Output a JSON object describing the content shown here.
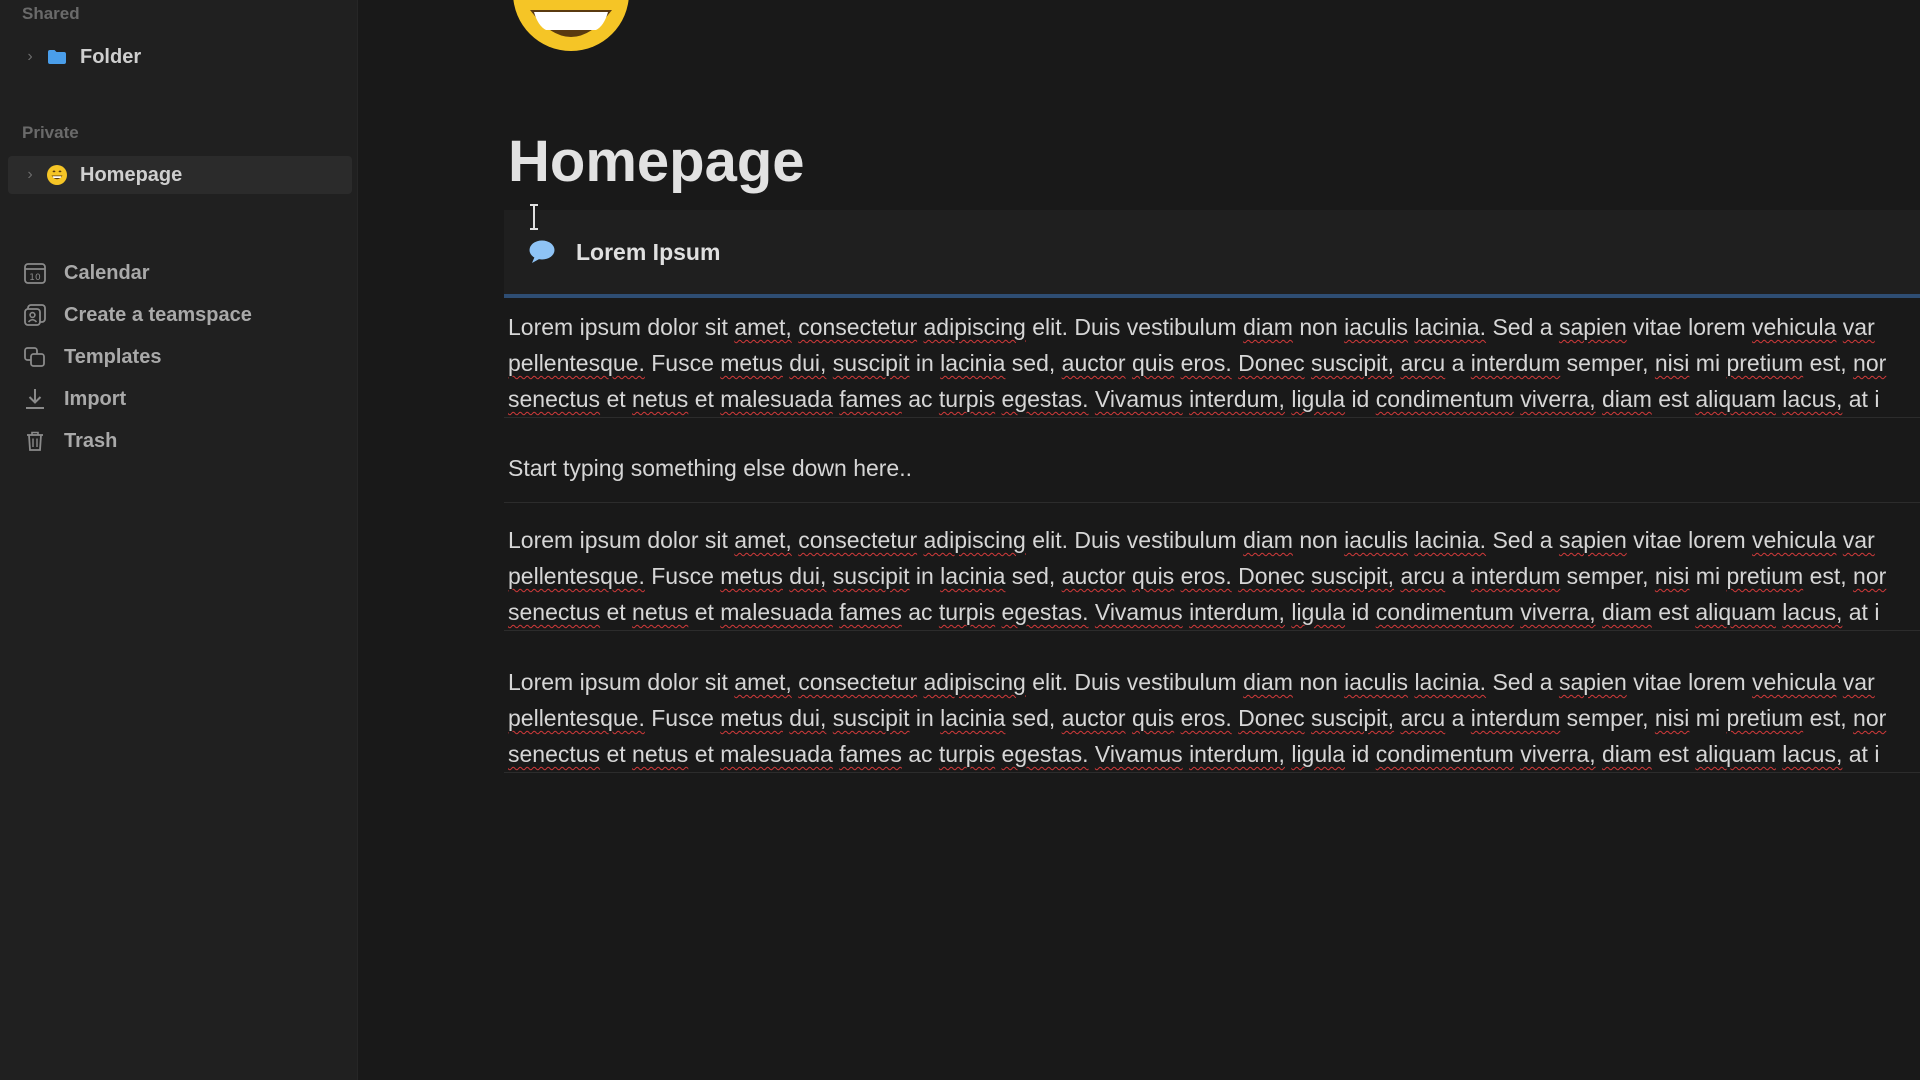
{
  "sidebar": {
    "shared_label": "Shared",
    "private_label": "Private",
    "shared_items": [
      {
        "label": "Folder",
        "icon": "folder-icon"
      }
    ],
    "private_items": [
      {
        "label": "Homepage",
        "icon": "smiley-emoji-icon",
        "active": true
      }
    ],
    "nav": [
      {
        "label": "Calendar",
        "icon": "calendar-icon"
      },
      {
        "label": "Create a teamspace",
        "icon": "teamspace-icon"
      },
      {
        "label": "Templates",
        "icon": "templates-icon"
      },
      {
        "label": "Import",
        "icon": "import-icon"
      },
      {
        "label": "Trash",
        "icon": "trash-icon"
      }
    ]
  },
  "page": {
    "emoji": "smiley-emoji-icon",
    "title": "Homepage",
    "callout": {
      "icon": "speech-bubble-icon",
      "text": "Lorem Ipsum"
    },
    "blocks": [
      {
        "lines": [
          "Lorem ipsum dolor sit amet, consectetur adipiscing elit. Duis vestibulum diam non iaculis lacinia. Sed a sapien vitae lorem vehicula var",
          "pellentesque. Fusce metus dui, suscipit in lacinia sed, auctor quis eros. Donec suscipit, arcu a interdum semper, nisi mi pretium est, nor",
          "senectus et netus et malesuada fames ac turpis egestas. Vivamus interdum, ligula id condimentum viverra, diam est aliquam lacus, at i"
        ]
      },
      {
        "text": "Start typing something else down here.."
      },
      {
        "lines": [
          "Lorem ipsum dolor sit amet, consectetur adipiscing elit. Duis vestibulum diam non iaculis lacinia. Sed a sapien vitae lorem vehicula var",
          "pellentesque. Fusce metus dui, suscipit in lacinia sed, auctor quis eros. Donec suscipit, arcu a interdum semper, nisi mi pretium est, nor",
          "senectus et netus et malesuada fames ac turpis egestas. Vivamus interdum, ligula id condimentum viverra, diam est aliquam lacus, at i"
        ]
      },
      {
        "lines": [
          "Lorem ipsum dolor sit amet, consectetur adipiscing elit. Duis vestibulum diam non iaculis lacinia. Sed a sapien vitae lorem vehicula var",
          "pellentesque. Fusce metus dui, suscipit in lacinia sed, auctor quis eros. Donec suscipit, arcu a interdum semper, nisi mi pretium est, nor",
          "senectus et netus et malesuada fames ac turpis egestas. Vivamus interdum, ligula id condimentum viverra, diam est aliquam lacus, at i"
        ]
      }
    ]
  },
  "colors": {
    "background": "#191919",
    "sidebar": "#202020",
    "callout_accent": "#2e4d73",
    "spellcheck": "#d23a3a",
    "folder_blue": "#4a9eea",
    "emoji_yellow": "#f5c526"
  }
}
